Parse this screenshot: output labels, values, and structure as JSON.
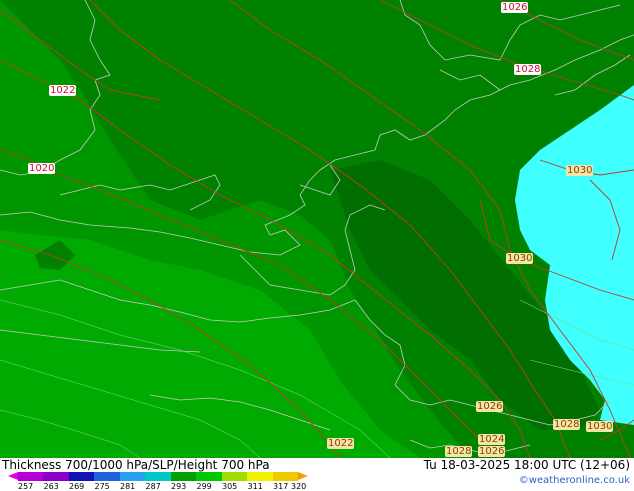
{
  "header": {
    "title": "Thickness 700/1000 hPa/SLP/Height 700 hPa",
    "valid_time": "Tu 18-03-2025 18:00 UTC (12+06)",
    "credit": "©weatheronline.co.uk"
  },
  "legend": {
    "ticks": [
      "257",
      "263",
      "269",
      "275",
      "281",
      "287",
      "293",
      "299",
      "305",
      "311",
      "317",
      "320"
    ],
    "colors": [
      "#e000e0",
      "#b400d8",
      "#8c00c8",
      "#1414b4",
      "#1e64dc",
      "#28a0f0",
      "#00c8c8",
      "#00a000",
      "#00c800",
      "#a0dc00",
      "#f0f000",
      "#f0c800",
      "#f0a000"
    ]
  },
  "isobar_labels": [
    {
      "id": "a",
      "text": "1026",
      "style": "red"
    },
    {
      "id": "b",
      "text": "1028",
      "style": "red"
    },
    {
      "id": "c",
      "text": "1022",
      "style": "red"
    },
    {
      "id": "d",
      "text": "1020",
      "style": "red"
    },
    {
      "id": "e",
      "text": "1030",
      "style": "olive"
    },
    {
      "id": "f",
      "text": "1030",
      "style": "olive"
    },
    {
      "id": "g",
      "text": "1026",
      "style": "olive"
    },
    {
      "id": "h",
      "text": "1028",
      "style": "olive"
    },
    {
      "id": "i",
      "text": "1030",
      "style": "olive"
    },
    {
      "id": "j",
      "text": "1022",
      "style": "olive"
    },
    {
      "id": "k",
      "text": "1024",
      "style": "olive"
    },
    {
      "id": "l",
      "text": "1028",
      "style": "olive"
    },
    {
      "id": "m",
      "text": "1026",
      "style": "olive"
    }
  ],
  "map_colors": {
    "dark_green": "#008200",
    "mid_green": "#009600",
    "light_green": "#00aa00",
    "cyan": "#40ffff",
    "isobar": "#c0392b",
    "coast": "#c8c8c8"
  }
}
